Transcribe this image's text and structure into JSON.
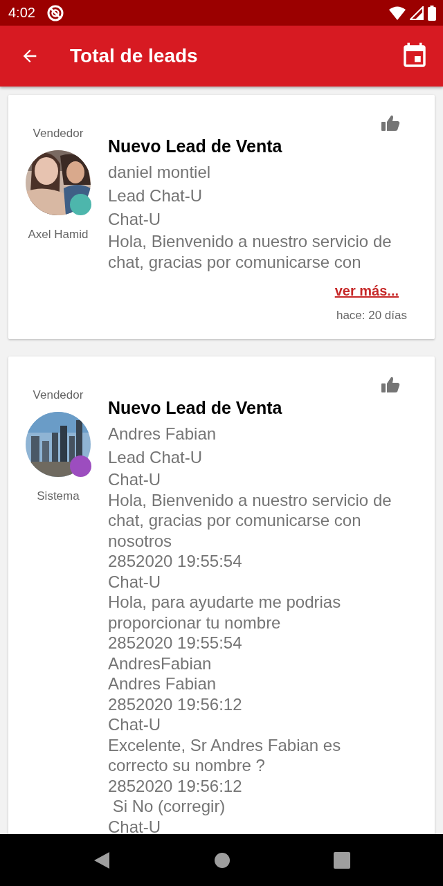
{
  "status_bar": {
    "time": "4:02"
  },
  "app_bar": {
    "title": "Total de leads"
  },
  "leads": [
    {
      "kind": "summary",
      "seller_label": "Vendedor",
      "seller_name": "Axel Hamid",
      "color": "#4db6ac",
      "title": "Nuevo Lead de Venta",
      "contact": "daniel montiel",
      "source": "Lead Chat-U",
      "channel": "Chat-U",
      "message": "Hola, Bienvenido a nuestro servicio de chat, gracias por comunicarse con",
      "link": "ver más...",
      "time": "hace: 20 días"
    },
    {
      "kind": "full",
      "seller_label": "Vendedor",
      "seller_name": "Sistema",
      "color": "#9c4dbf",
      "title": "Nuevo Lead de Venta",
      "contact": "Andres Fabian",
      "source": "Lead Chat-U",
      "lines": [
        "Chat-U",
        "Hola, Bienvenido a nuestro servicio de chat, gracias por comunicarse con nosotros",
        "2852020 19:55:54",
        "Chat-U",
        "Hola, para ayudarte me podrias proporcionar tu nombre",
        "2852020 19:55:54",
        "AndresFabian",
        "Andres Fabian",
        "2852020 19:56:12",
        "Chat-U",
        "Excelente, Sr Andres Fabian es correcto su nombre ?",
        "2852020 19:56:12",
        " Si No (corregir)",
        "Chat-U"
      ]
    }
  ]
}
